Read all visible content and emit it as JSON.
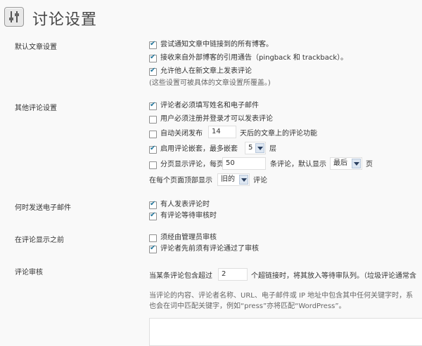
{
  "page": {
    "title": "讨论设置"
  },
  "sections": {
    "default_article": {
      "label": "默认文章设置",
      "options": [
        {
          "text": "尝试通知文章中链接到的所有博客。",
          "checked": true
        },
        {
          "text": "接收来自外部博客的引用通告（pingback 和 trackback）。",
          "checked": true
        },
        {
          "text": "允许他人在新文章上发表评论",
          "checked": true
        }
      ],
      "note": "(这些设置可被具体的文章设置所覆盖。)"
    },
    "other_comment": {
      "label": "其他评论设置",
      "require_name_email": {
        "text": "评论者必须填写姓名和电子邮件",
        "checked": true
      },
      "require_login": {
        "text": "用户必须注册并登录才可以发表评论",
        "checked": false
      },
      "auto_close": {
        "checked": false,
        "before": "自动关闭发布",
        "value": "14",
        "after": "天后的文章上的评论功能"
      },
      "threaded": {
        "checked": true,
        "before": "启用评论嵌套，最多嵌套",
        "value": "5",
        "after": "层"
      },
      "paged": {
        "checked": false,
        "before": "分页显示评论，每页显示",
        "value": "50",
        "middle": "条评论，默认显示",
        "select": "最后",
        "after": "页"
      },
      "top_page": {
        "before": "在每个页面顶部显示",
        "select": "旧的",
        "after": "评论"
      }
    },
    "email_me": {
      "label": "何时发送电子邮件",
      "options": [
        {
          "text": "有人发表评论时",
          "checked": true
        },
        {
          "text": "有评论等待审核时",
          "checked": true
        }
      ]
    },
    "before_appear": {
      "label": "在评论显示之前",
      "options": [
        {
          "text": "须经由管理员审核",
          "checked": false
        },
        {
          "text": "评论者先前须有评论通过了审核",
          "checked": true
        }
      ]
    },
    "moderation": {
      "label": "评论审核",
      "line_before": "当某条评论包含超过",
      "links_value": "2",
      "line_after": "个超链接时，将其放入等待审队列。（垃圾评论通常含",
      "desc1": "当评论的内容、评论者名称、URL、电子邮件或 IP 地址中包含其中任何关键字时，系",
      "desc2": "也会在词中匹配关键字，例如“press”亦将匹配“WordPress”。"
    }
  },
  "colors": {
    "check": "#21759b",
    "border": "#dfdfdf"
  },
  "icons": {
    "header": "settings-sliders-icon"
  }
}
